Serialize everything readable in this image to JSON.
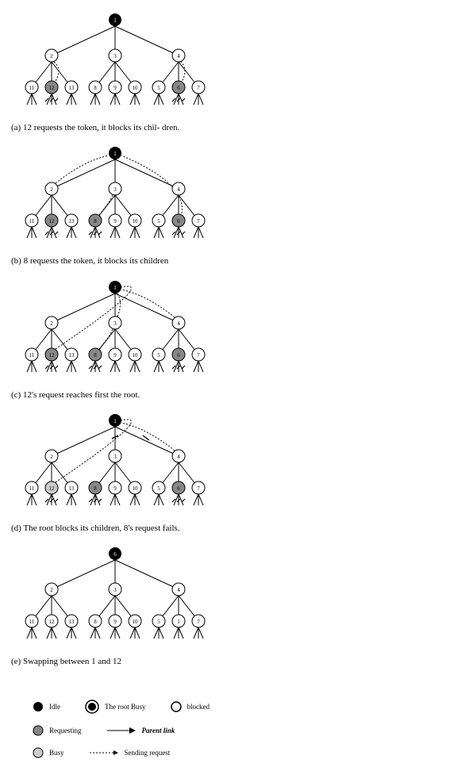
{
  "captions": {
    "a": "(a) 12 requests the token, it blocks its chil-\ndren.",
    "b": "(b) 8 requests the token, it blocks its children",
    "c": "(c) 12's request reaches first the root.",
    "d": "(d) The root blocks its children, 8's request fails.",
    "e": "(e) Swapping between 1 and 12"
  },
  "legend": {
    "idle": "Idle",
    "requesting": "Requesting",
    "busy": "Busy",
    "root_busy": "The root Busy",
    "parent_link": "Parent link",
    "sending_request": "Sending request",
    "blocked": "blocked"
  },
  "chart_data": [
    {
      "id": "a",
      "description": "12 requests the token, it blocks its children.",
      "tree": {
        "root": 1,
        "children": {
          "1": [
            2,
            3,
            4
          ],
          "2": [
            11,
            12,
            13
          ],
          "3": [
            8,
            9,
            10
          ],
          "4": [
            5,
            6,
            7
          ]
        }
      },
      "states": {
        "1": "root",
        "12": "requesting",
        "6": "requesting"
      },
      "blocked_edges": [
        [
          12,
          "c1"
        ],
        [
          12,
          "c2"
        ],
        [
          12,
          "c3"
        ]
      ],
      "blocked_leaves_of": [
        12,
        6
      ],
      "dotted_requests": [
        [
          12,
          2
        ],
        [
          6,
          4
        ]
      ]
    },
    {
      "id": "b",
      "description": "8 requests the token, it blocks its children",
      "tree": {
        "root": 1,
        "children": {
          "1": [
            2,
            3,
            4
          ],
          "2": [
            11,
            12,
            13
          ],
          "3": [
            8,
            9,
            10
          ],
          "4": [
            5,
            6,
            7
          ]
        }
      },
      "states": {
        "1": "root",
        "12": "requesting",
        "8": "requesting",
        "6": "requesting"
      },
      "blocked_edges": [],
      "blocked_leaves_of": [
        12,
        8,
        6
      ],
      "dotted_requests": [
        [
          8,
          3
        ],
        [
          12,
          1
        ],
        [
          6,
          1
        ]
      ],
      "dotted_curve_from_2_to_1": true
    },
    {
      "id": "c",
      "description": "12's request reaches first the root.",
      "tree": {
        "root": 1,
        "children": {
          "1": [
            2,
            3,
            4
          ],
          "2": [
            11,
            12,
            13
          ],
          "3": [
            8,
            9,
            10
          ],
          "4": [
            5,
            6,
            7
          ]
        }
      },
      "states": {
        "1": "root",
        "12": "requesting",
        "8": "requesting",
        "6": "requesting"
      },
      "blocked_leaves_of": [
        12,
        8,
        6
      ],
      "dotted_requests": [
        [
          8,
          3
        ],
        [
          3,
          1
        ],
        [
          4,
          1
        ]
      ],
      "dotted_curve_from_12_to_1": true
    },
    {
      "id": "d",
      "description": "The root blocks its children, 8's request fails.",
      "tree": {
        "root": 1,
        "children": {
          "1": [
            2,
            3,
            4
          ],
          "2": [
            11,
            12,
            13
          ],
          "3": [
            8,
            9,
            10
          ],
          "4": [
            5,
            6,
            7
          ]
        }
      },
      "states": {
        "1": "root",
        "12": "busy",
        "8": "requesting",
        "6": "requesting"
      },
      "blocked_nodes": [
        3,
        4
      ],
      "blocked_leaves_of": [
        12,
        8,
        6
      ],
      "dotted_requests": [
        [
          4,
          1
        ]
      ],
      "dotted_curve_from_12_to_1": true
    },
    {
      "id": "e",
      "description": "Swapping between 1 and 12",
      "tree": {
        "root": 6,
        "children": {
          "6": [
            2,
            3,
            4
          ],
          "2": [
            11,
            12,
            13
          ],
          "3": [
            8,
            9,
            10
          ],
          "4": [
            5,
            1,
            7
          ]
        }
      },
      "states": {
        "6": "root"
      },
      "blocked_leaves_of": [],
      "dotted_requests": []
    }
  ]
}
